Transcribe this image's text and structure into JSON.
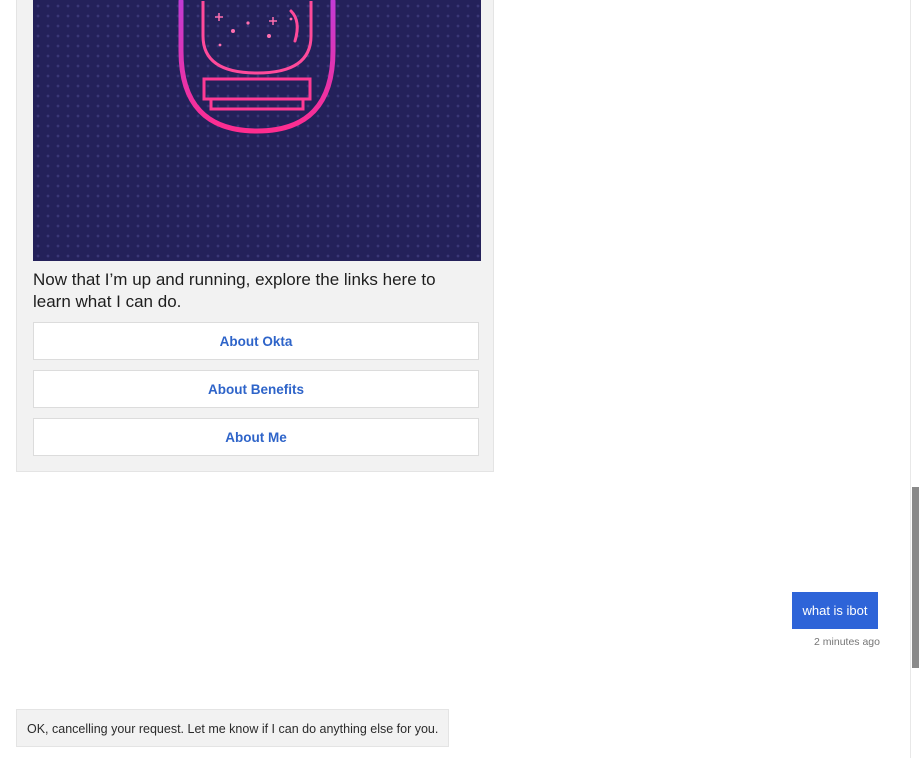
{
  "hero_card": {
    "image_icon": "astronaut-helmet-icon",
    "text": "Now that I’m up and running, explore the links here to learn what I can do.",
    "buttons": [
      {
        "label": "About Okta"
      },
      {
        "label": "About Benefits"
      },
      {
        "label": "About Me"
      }
    ]
  },
  "user_message": {
    "text": "what is ibot",
    "timestamp": "2 minutes ago"
  },
  "bot_message": {
    "text": "OK, cancelling your request. Let me know if I can do anything else for you."
  },
  "colors": {
    "accent": "#2e64d8",
    "link": "#2e64c9",
    "hero_bg": "#24215a",
    "helmet_pink": "#ff2d8f",
    "bubble_bg": "#f2f2f2"
  }
}
